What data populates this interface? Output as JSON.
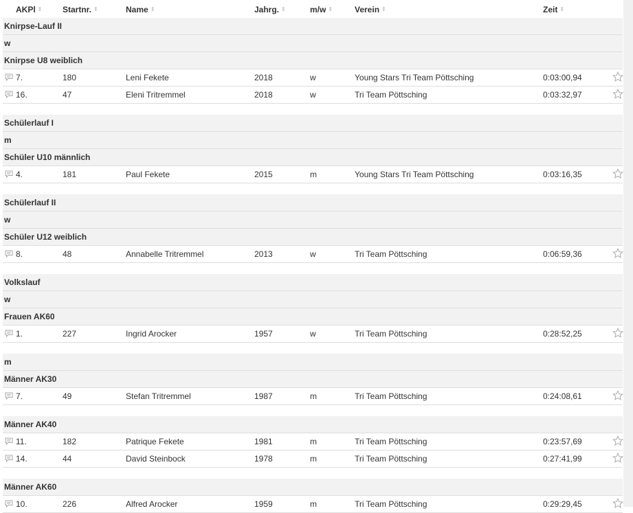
{
  "columns": [
    {
      "key": "akpl",
      "label": "AKPl"
    },
    {
      "key": "startnr",
      "label": "Startnr."
    },
    {
      "key": "name",
      "label": "Name"
    },
    {
      "key": "jahrg",
      "label": "Jahrg."
    },
    {
      "key": "mw",
      "label": "m/w"
    },
    {
      "key": "verein",
      "label": "Verein"
    },
    {
      "key": "zeit",
      "label": "Zeit"
    }
  ],
  "sections": [
    {
      "type": "group",
      "label": "Knirpse-Lauf II"
    },
    {
      "type": "group",
      "label": "w"
    },
    {
      "type": "group",
      "label": "Knirpse U8 weiblich"
    },
    {
      "type": "row",
      "akpl": "7.",
      "startnr": "180",
      "name": "Leni Fekete",
      "jahrg": "2018",
      "mw": "w",
      "verein": "Young Stars Tri Team Pöttsching",
      "zeit": "0:03:00,94"
    },
    {
      "type": "row",
      "akpl": "16.",
      "startnr": "47",
      "name": "Eleni Tritremmel",
      "jahrg": "2018",
      "mw": "w",
      "verein": "Tri Team Pöttsching",
      "zeit": "0:03:32,97"
    },
    {
      "type": "spacer"
    },
    {
      "type": "group",
      "label": "Schülerlauf I"
    },
    {
      "type": "group",
      "label": "m"
    },
    {
      "type": "group",
      "label": "Schüler U10 männlich"
    },
    {
      "type": "row",
      "akpl": "4.",
      "startnr": "181",
      "name": "Paul Fekete",
      "jahrg": "2015",
      "mw": "m",
      "verein": "Young Stars Tri Team Pöttsching",
      "zeit": "0:03:16,35"
    },
    {
      "type": "spacer"
    },
    {
      "type": "group",
      "label": "Schülerlauf II"
    },
    {
      "type": "group",
      "label": "w"
    },
    {
      "type": "group",
      "label": "Schüler U12 weiblich"
    },
    {
      "type": "row",
      "akpl": "8.",
      "startnr": "48",
      "name": "Annabelle Tritremmel",
      "jahrg": "2013",
      "mw": "w",
      "verein": "Tri Team Pöttsching",
      "zeit": "0:06:59,36"
    },
    {
      "type": "spacer"
    },
    {
      "type": "group",
      "label": "Volkslauf"
    },
    {
      "type": "group",
      "label": "w"
    },
    {
      "type": "group",
      "label": "Frauen AK60"
    },
    {
      "type": "row",
      "akpl": "1.",
      "startnr": "227",
      "name": "Ingrid Arocker",
      "jahrg": "1957",
      "mw": "w",
      "verein": "Tri Team Pöttsching",
      "zeit": "0:28:52,25"
    },
    {
      "type": "spacer"
    },
    {
      "type": "group",
      "label": "m"
    },
    {
      "type": "group",
      "label": "Männer AK30"
    },
    {
      "type": "row",
      "akpl": "7.",
      "startnr": "49",
      "name": "Stefan Tritremmel",
      "jahrg": "1987",
      "mw": "m",
      "verein": "Tri Team Pöttsching",
      "zeit": "0:24:08,61"
    },
    {
      "type": "spacer"
    },
    {
      "type": "group",
      "label": "Männer AK40"
    },
    {
      "type": "row",
      "akpl": "11.",
      "startnr": "182",
      "name": "Patrique Fekete",
      "jahrg": "1981",
      "mw": "m",
      "verein": "Tri Team Pöttsching",
      "zeit": "0:23:57,69"
    },
    {
      "type": "row",
      "akpl": "14.",
      "startnr": "44",
      "name": "David Steinbock",
      "jahrg": "1978",
      "mw": "m",
      "verein": "Tri Team Pöttsching",
      "zeit": "0:27:41,99"
    },
    {
      "type": "spacer"
    },
    {
      "type": "group",
      "label": "Männer AK60"
    },
    {
      "type": "row",
      "akpl": "10.",
      "startnr": "226",
      "name": "Alfred Arocker",
      "jahrg": "1959",
      "mw": "m",
      "verein": "Tri Team Pöttsching",
      "zeit": "0:29:29,45"
    }
  ],
  "icons": {
    "comment": "comment-icon",
    "favorite": "star-outline-icon",
    "sort": "sort-arrows-icon"
  },
  "colors": {
    "group_bg": "#f2f2f2",
    "border": "#dddddd",
    "icon": "#aaaaaa"
  }
}
